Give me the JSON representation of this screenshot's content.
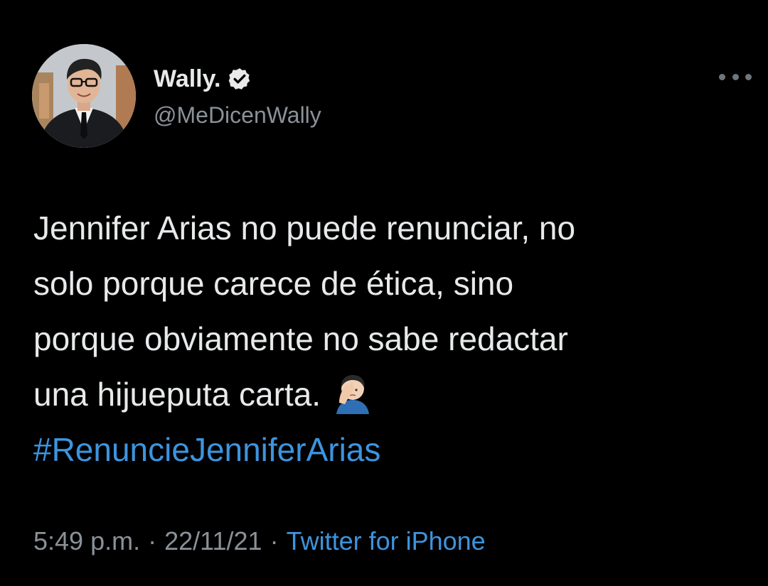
{
  "author": {
    "display_name": "Wally.",
    "handle": "@MeDicenWally",
    "verified": true,
    "avatar_icon": "profile-photo"
  },
  "menu": {
    "icon": "more-options-icon"
  },
  "tweet": {
    "lines": [
      "Jennifer Arias no puede renunciar, no",
      "solo porque carece de ética, sino",
      "porque obviamente no sabe redactar",
      "una hijueputa carta."
    ],
    "emoji": "🤦🏻‍♂️",
    "hashtag": "#RenuncieJenniferArias"
  },
  "meta": {
    "time": "5:49 p.m.",
    "separator": "·",
    "date": "22/11/21",
    "source": "Twitter for iPhone"
  },
  "colors": {
    "background": "#000000",
    "text": "#e7e9ea",
    "secondary": "#8b9198",
    "link": "#3d94de"
  }
}
